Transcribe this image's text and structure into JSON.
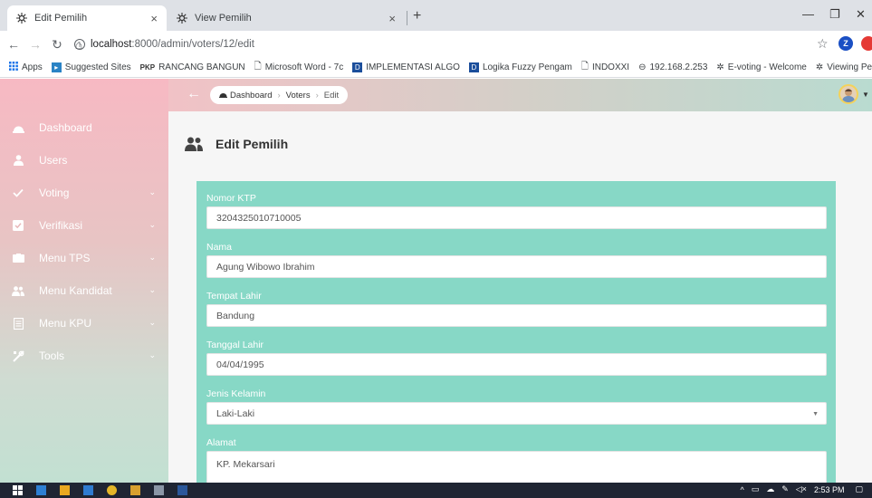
{
  "browser": {
    "tabs": [
      {
        "title": "Edit Pemilih",
        "close": "×"
      },
      {
        "title": "View Pemilih",
        "close": "×"
      }
    ],
    "new_tab": "+",
    "window": {
      "minimize": "—",
      "restore": "❐",
      "close": "✕"
    },
    "url_host": "localhost",
    "url_path": ":8000/admin/voters/12/edit",
    "extension_letter": "Z",
    "bookmarks": [
      "Apps",
      "Suggested Sites",
      "RANCANG BANGUN",
      "Microsoft Word - 7c",
      "IMPLEMENTASI ALGO",
      "Logika Fuzzy Pengam",
      "INDOXXI",
      "192.168.2.253",
      "E-voting - Welcome",
      "Viewing Pemilih"
    ],
    "bookmark_prefix_pkp": "PKP"
  },
  "sidebar": {
    "items": [
      {
        "label": "Dashboard",
        "icon": "dashboard-icon",
        "has_chevron": false
      },
      {
        "label": "Users",
        "icon": "user-icon",
        "has_chevron": false
      },
      {
        "label": "Voting",
        "icon": "check-icon",
        "has_chevron": true
      },
      {
        "label": "Verifikasi",
        "icon": "verify-icon",
        "has_chevron": true
      },
      {
        "label": "Menu TPS",
        "icon": "box-icon",
        "has_chevron": true
      },
      {
        "label": "Menu Kandidat",
        "icon": "users-icon",
        "has_chevron": true
      },
      {
        "label": "Menu KPU",
        "icon": "document-icon",
        "has_chevron": true
      },
      {
        "label": "Tools",
        "icon": "tools-icon",
        "has_chevron": true
      }
    ],
    "chevron": "⌄"
  },
  "topbar": {
    "back": "←",
    "breadcrumb": [
      "Dashboard",
      "Voters",
      "Edit"
    ],
    "separator": "›"
  },
  "page": {
    "title": "Edit Pemilih"
  },
  "form": {
    "fields": [
      {
        "label": "Nomor KTP",
        "value": "3204325010710005",
        "type": "text"
      },
      {
        "label": "Nama",
        "value": "Agung Wibowo Ibrahim",
        "type": "text"
      },
      {
        "label": "Tempat Lahir",
        "value": "Bandung",
        "type": "text"
      },
      {
        "label": "Tanggal Lahir",
        "value": "04/04/1995",
        "type": "date"
      },
      {
        "label": "Jenis Kelamin",
        "value": "Laki-Laki",
        "type": "select"
      },
      {
        "label": "Alamat",
        "value": "KP. Mekarsari",
        "type": "textarea"
      }
    ]
  },
  "taskbar": {
    "time": "2:53 PM",
    "tray_arrow": "^"
  },
  "colors": {
    "form_bg": "#87d8c6",
    "sidebar_top": "#f7b9c3",
    "sidebar_bottom": "#c2e0d2",
    "taskbar": "#1f2533"
  }
}
